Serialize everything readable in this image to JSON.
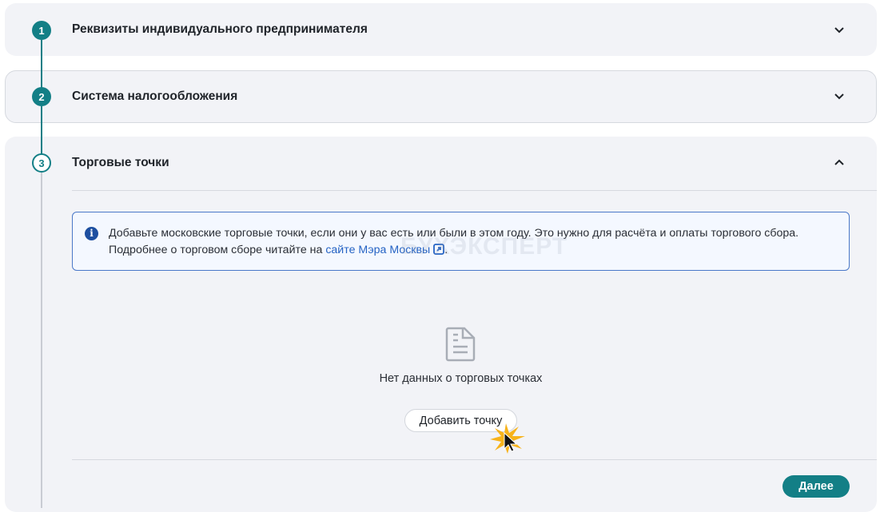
{
  "steps": [
    {
      "number": "1",
      "title": "Реквизиты индивидуального предпринимателя",
      "expanded": false
    },
    {
      "number": "2",
      "title": "Система налогообложения",
      "expanded": false
    },
    {
      "number": "3",
      "title": "Торговые точки",
      "expanded": true
    }
  ],
  "info": {
    "text": "Добавьте московские торговые точки, если они у вас есть или были в этом году. Это нужно для расчёта и оплаты торгового сбора. Подробнее о торговом сборе читайте на ",
    "link": "сайте Мэра Москвы",
    "end": "."
  },
  "watermark": "БУХЭКСПЕРТ",
  "empty": {
    "text": "Нет данных о торговых точках",
    "add_button": "Добавить точку"
  },
  "next_button": "Далее",
  "colors": {
    "accent": "#137f86",
    "link": "#2563c4"
  }
}
